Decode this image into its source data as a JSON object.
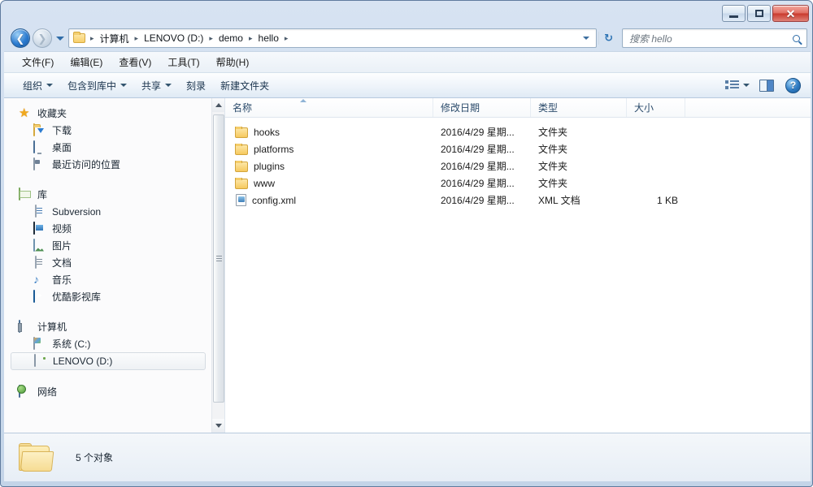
{
  "window": {
    "title": "",
    "controls": {
      "minimize": "minimize",
      "maximize": "restore",
      "close": "close"
    }
  },
  "address_bar": {
    "back_label": "←",
    "forward_label": "→",
    "crumbs": [
      "计算机",
      "LENOVO (D:)",
      "demo",
      "hello"
    ],
    "separator": "▸",
    "refresh_label": "↻"
  },
  "search": {
    "placeholder": "搜索 hello",
    "icon": "search-icon"
  },
  "menubar": {
    "items": [
      {
        "label": "文件(F)"
      },
      {
        "label": "编辑(E)"
      },
      {
        "label": "查看(V)"
      },
      {
        "label": "工具(T)"
      },
      {
        "label": "帮助(H)"
      }
    ]
  },
  "toolbar": {
    "items": [
      {
        "label": "组织",
        "caret": true
      },
      {
        "label": "包含到库中",
        "caret": true
      },
      {
        "label": "共享",
        "caret": true
      },
      {
        "label": "刻录",
        "caret": false
      },
      {
        "label": "新建文件夹",
        "caret": false
      }
    ],
    "right_icons": [
      "view-mode-icon",
      "chevron-down-icon",
      "preview-pane-icon",
      "help-icon"
    ],
    "help_label": "?"
  },
  "sidebar": {
    "groups": [
      {
        "header": {
          "label": "收藏夹",
          "icon": "star-icon"
        },
        "children": [
          {
            "label": "下载",
            "icon": "downloads-icon"
          },
          {
            "label": "桌面",
            "icon": "desktop-icon"
          },
          {
            "label": "最近访问的位置",
            "icon": "recent-places-icon"
          }
        ]
      },
      {
        "header": {
          "label": "库",
          "icon": "library-icon"
        },
        "children": [
          {
            "label": "Subversion",
            "icon": "subversion-icon"
          },
          {
            "label": "视频",
            "icon": "video-icon"
          },
          {
            "label": "图片",
            "icon": "pictures-icon"
          },
          {
            "label": "文档",
            "icon": "documents-icon"
          },
          {
            "label": "音乐",
            "icon": "music-icon"
          },
          {
            "label": "优酷影视库",
            "icon": "youku-icon"
          }
        ]
      },
      {
        "header": {
          "label": "计算机",
          "icon": "computer-icon"
        },
        "children": [
          {
            "label": "系统 (C:)",
            "icon": "system-drive-icon",
            "selected": false
          },
          {
            "label": "LENOVO (D:)",
            "icon": "drive-icon",
            "selected": true
          }
        ]
      },
      {
        "header": {
          "label": "网络",
          "icon": "network-icon"
        },
        "children": []
      }
    ]
  },
  "filelist": {
    "columns": [
      {
        "key": "name",
        "label": "名称",
        "sorted": "asc"
      },
      {
        "key": "date",
        "label": "修改日期"
      },
      {
        "key": "type",
        "label": "类型"
      },
      {
        "key": "size",
        "label": "大小"
      }
    ],
    "rows": [
      {
        "name": "hooks",
        "date": "2016/4/29 星期...",
        "type": "文件夹",
        "size": "",
        "icon": "folder-icon"
      },
      {
        "name": "platforms",
        "date": "2016/4/29 星期...",
        "type": "文件夹",
        "size": "",
        "icon": "folder-icon"
      },
      {
        "name": "plugins",
        "date": "2016/4/29 星期...",
        "type": "文件夹",
        "size": "",
        "icon": "folder-icon"
      },
      {
        "name": "www",
        "date": "2016/4/29 星期...",
        "type": "文件夹",
        "size": "",
        "icon": "folder-icon"
      },
      {
        "name": "config.xml",
        "date": "2016/4/29 星期...",
        "type": "XML 文档",
        "size": "1 KB",
        "icon": "xml-file-icon"
      }
    ]
  },
  "statusbar": {
    "icon": "open-folder-icon",
    "text": "5 个对象"
  },
  "colors": {
    "frame": "#c3d4e8",
    "accent": "#2f6ca8",
    "close_red": "#c9392c",
    "folder_yellow": "#f6c95e",
    "header_text": "#2b4b6b"
  }
}
